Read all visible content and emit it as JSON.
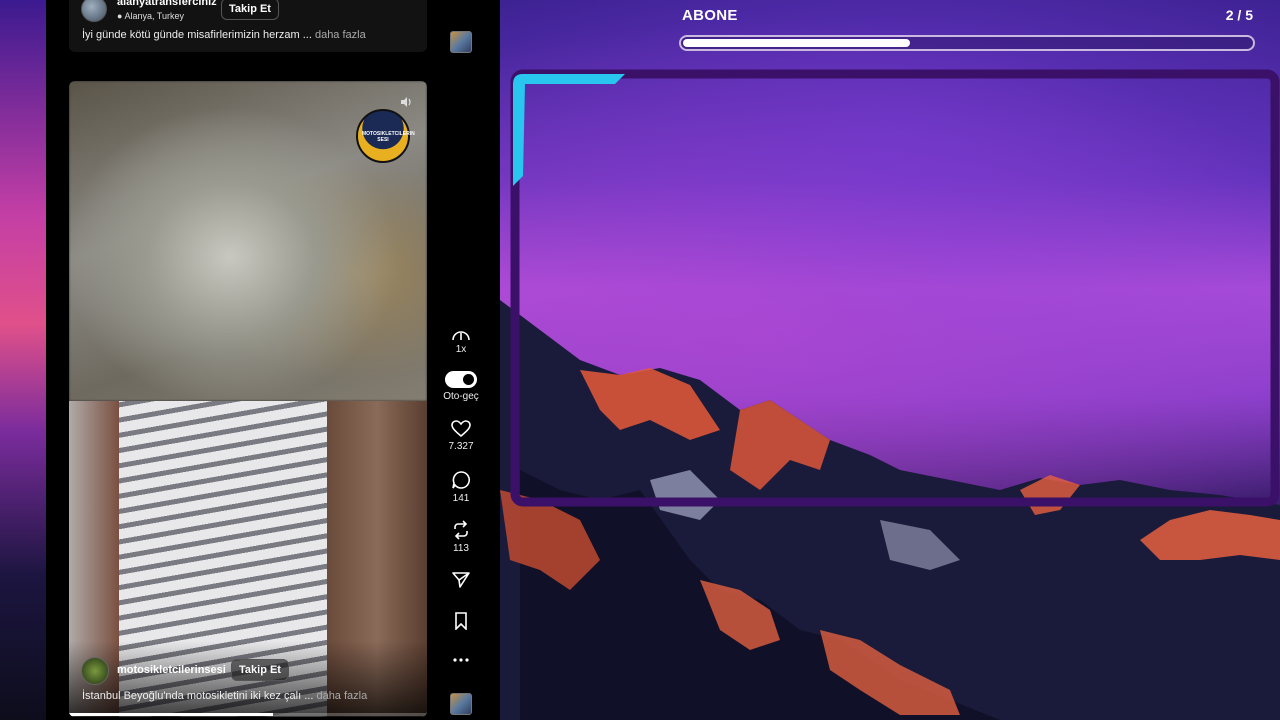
{
  "top_post": {
    "username": "alanyatransferciniz",
    "location": "Alanya, Turkey",
    "follow_label": "Takip Et",
    "caption": "İyi günde kötü günde misafirlerimizin herzam ...",
    "more_label": "daha fazla"
  },
  "video_post": {
    "username": "motosikletcilerinsesi",
    "follow_label": "Takip Et",
    "caption": "İstanbul Beyoğlu'nda motosikletini iki kez çalı ...",
    "more_label": "daha fazla",
    "progress_fraction": 0.57
  },
  "rail": {
    "speed_label": "1x",
    "autoplay_label": "Oto-geç",
    "like_count": "7.327",
    "comment_count": "141",
    "repost_count": "113",
    "icons": [
      "more-icon",
      "speed-icon",
      "autoplay-toggle",
      "heart-icon",
      "comment-icon",
      "repost-icon",
      "share-icon",
      "bookmark-icon",
      "more-icon"
    ]
  },
  "overlay": {
    "title": "ABONE",
    "counter": "2 / 5",
    "progress_fraction": 0.4
  },
  "colors": {
    "frame": "#3a1068",
    "frame_accent": "#29c6f0",
    "panel_bg": "#000000"
  }
}
